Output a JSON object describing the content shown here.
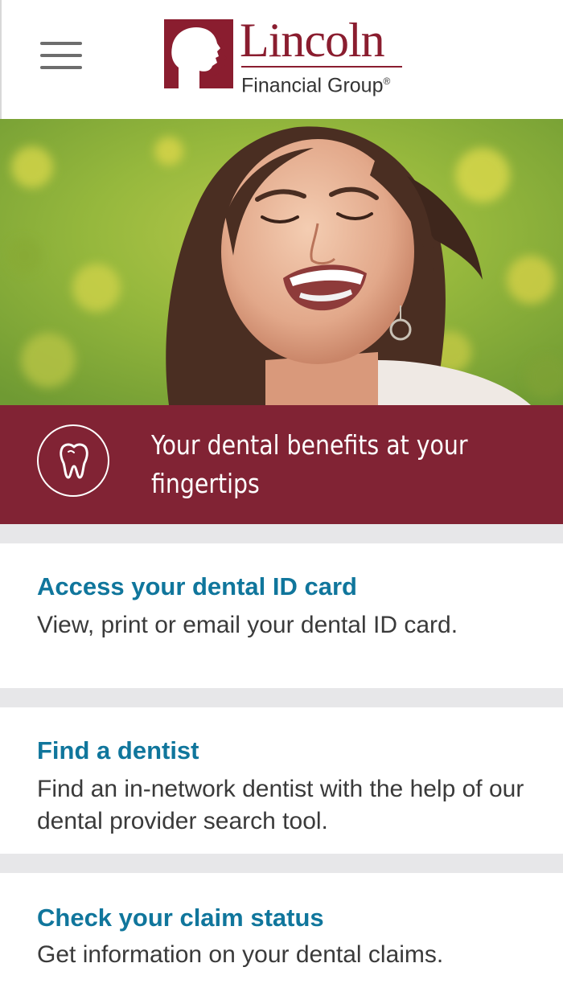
{
  "header": {
    "menu_icon": "hamburger-menu-icon",
    "logo": {
      "name": "Lincoln",
      "subtitle": "Financial Group",
      "registered": "®",
      "brand_color": "#8a1d2f"
    }
  },
  "hero": {
    "image": "smiling-woman-photo"
  },
  "banner": {
    "icon": "tooth-icon",
    "text": "Your dental benefits at your fingertips",
    "background": "#812334"
  },
  "cards": [
    {
      "title": "Access your dental ID card",
      "description": "View, print or email your dental ID card."
    },
    {
      "title": "Find a dentist",
      "description": "Find an in-network dentist with the help of our dental provider search tool."
    },
    {
      "title": "Check your claim status",
      "description": "Get information on your dental claims."
    }
  ],
  "colors": {
    "link": "#10769c",
    "body_text": "#3a3a3a",
    "divider": "#e7e7e9"
  }
}
